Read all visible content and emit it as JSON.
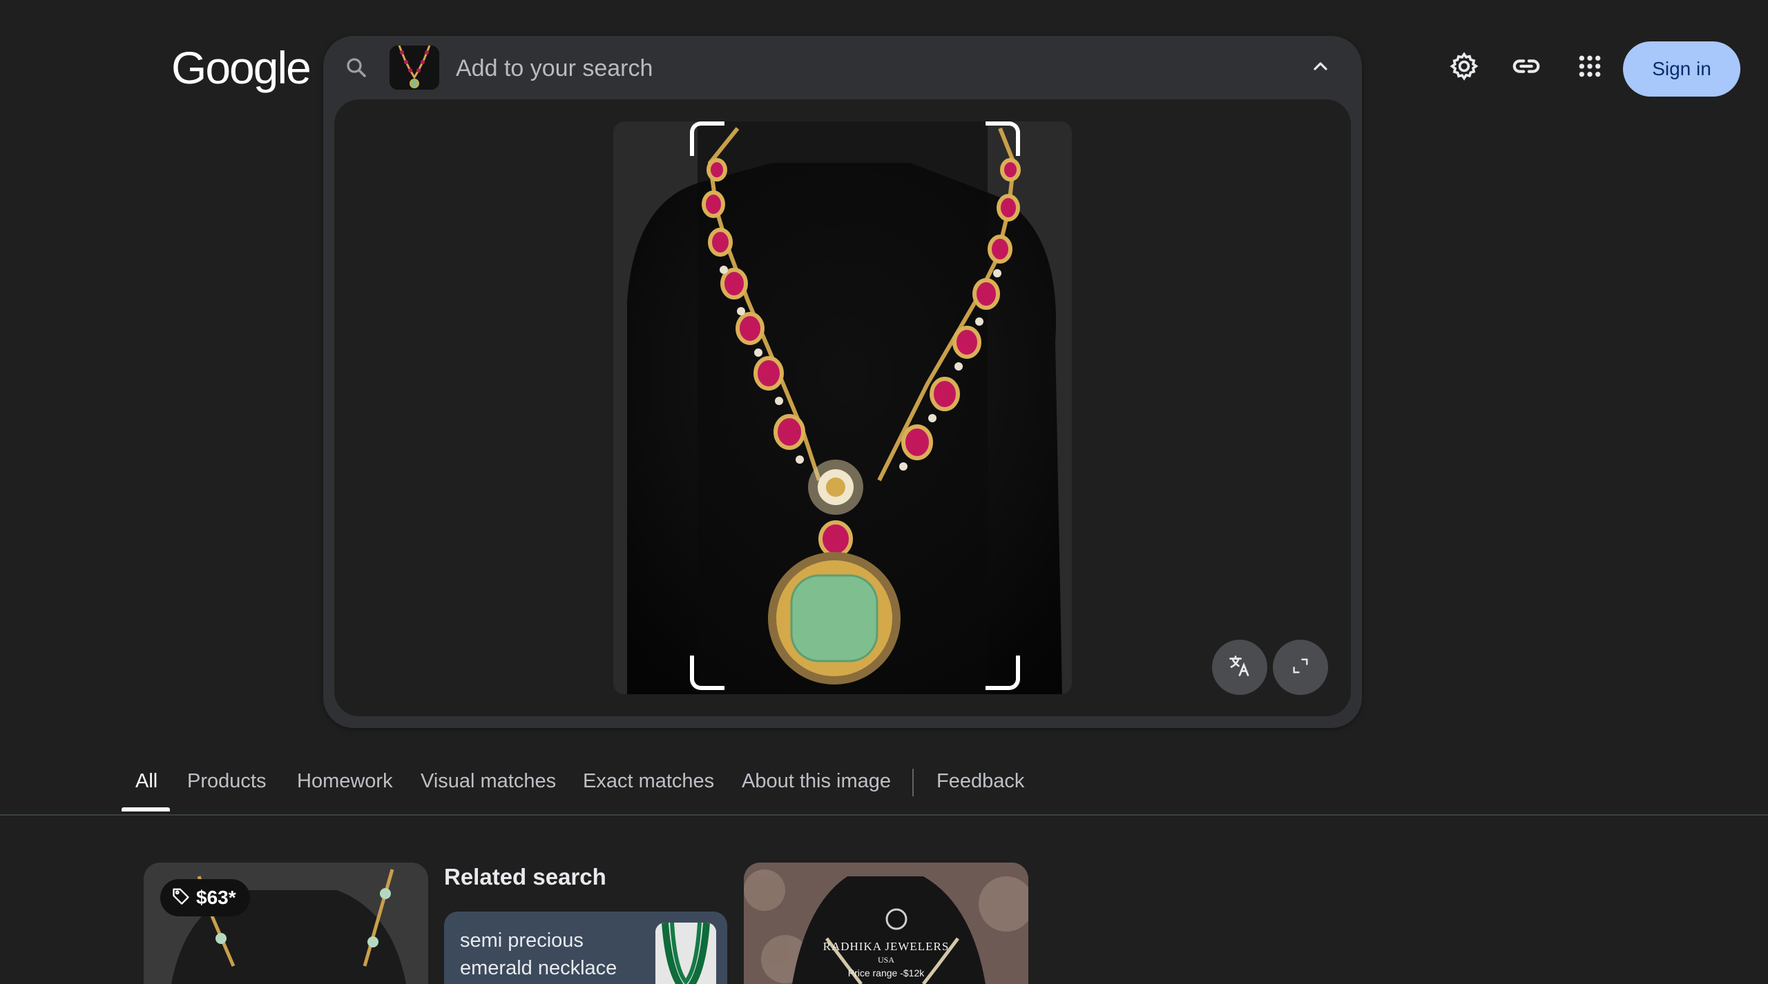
{
  "header": {
    "logo_text": "Google",
    "search_placeholder": "Add to your search",
    "signin_label": "Sign in"
  },
  "icons": {
    "search": "search-icon",
    "collapse": "chevron-up-icon",
    "translate": "translate-icon",
    "fullscreen": "fullscreen-icon",
    "settings": "gear-icon",
    "link": "link-icon",
    "apps": "apps-grid-icon",
    "price_tag": "tag-icon"
  },
  "tabs": [
    {
      "label": "All",
      "active": true
    },
    {
      "label": "Products",
      "active": false
    },
    {
      "label": "Homework",
      "active": false
    },
    {
      "label": "Visual matches",
      "active": false
    },
    {
      "label": "Exact matches",
      "active": false
    },
    {
      "label": "About this image",
      "active": false
    },
    {
      "label": "Feedback",
      "active": false
    }
  ],
  "results": {
    "first_card_price": "$63*",
    "related_title": "Related search",
    "related_chip_label": "semi precious emerald necklace",
    "third_card_brand": "Radhika Jewelers",
    "third_card_country": "USA",
    "third_card_price_range": "Price range -$12k"
  },
  "colors": {
    "background": "#1f1f1f",
    "search_card": "#303134",
    "signin_bg": "#a8c7fa",
    "ruby": "#c2185b",
    "emerald": "#7fbf8f",
    "gold": "#d4a94a"
  }
}
